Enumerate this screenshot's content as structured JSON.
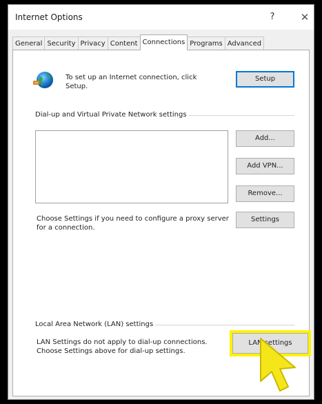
{
  "window": {
    "title": "Internet Options",
    "help_label": "?",
    "close_label": "✕"
  },
  "tabs": [
    {
      "label": "General",
      "active": false
    },
    {
      "label": "Security",
      "active": false
    },
    {
      "label": "Privacy",
      "active": false
    },
    {
      "label": "Content",
      "active": false
    },
    {
      "label": "Connections",
      "active": true
    },
    {
      "label": "Programs",
      "active": false
    },
    {
      "label": "Advanced",
      "active": false
    }
  ],
  "connections": {
    "setup_text": "To set up an Internet connection, click Setup.",
    "setup_button": "Setup",
    "dialup_group_label": "Dial-up and Virtual Private Network settings",
    "add_button": "Add...",
    "add_vpn_button": "Add VPN...",
    "remove_button": "Remove...",
    "proxy_text": "Choose Settings if you need to configure a proxy server for a connection.",
    "settings_button": "Settings",
    "lan_group_label": "Local Area Network (LAN) settings",
    "lan_text": "LAN Settings do not apply to dial-up connections. Choose Settings above for dial-up settings.",
    "lan_button": "LAN settings"
  },
  "colors": {
    "highlight": "#fff200",
    "cursor": "#f5e61a",
    "accent": "#0078d7"
  },
  "icons": {
    "setup_icon": "globe-icon",
    "pointer": "cursor-icon"
  }
}
